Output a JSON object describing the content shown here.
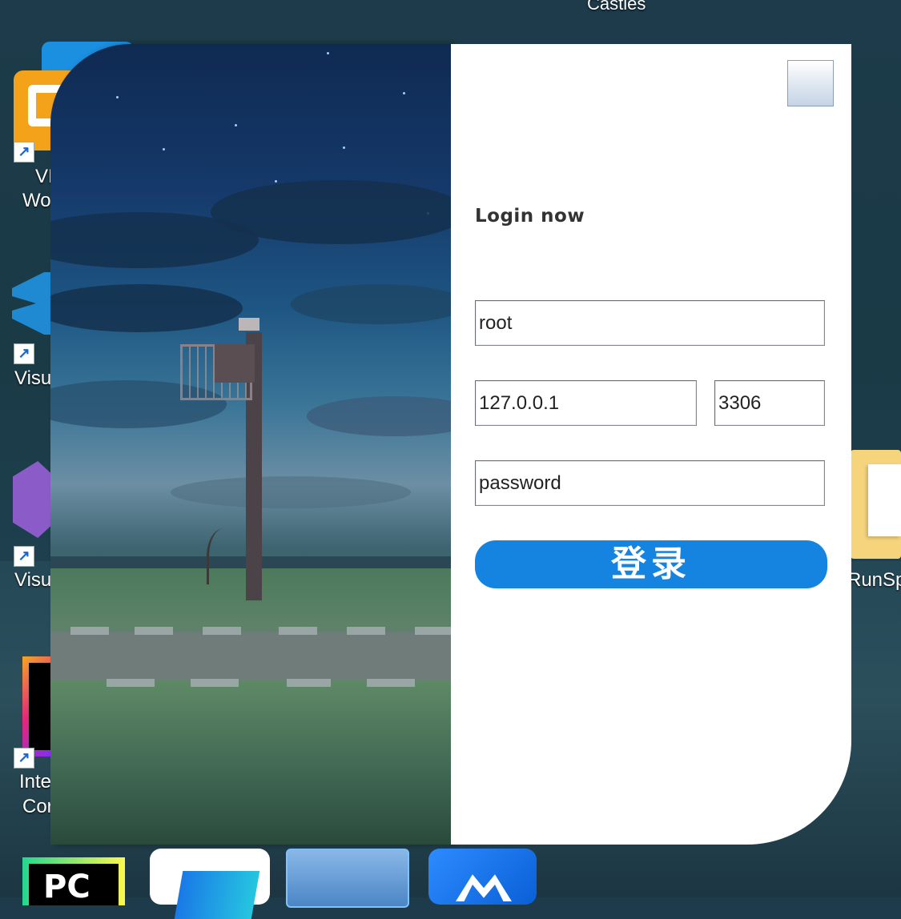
{
  "desktop": {
    "top_label": "Castles",
    "icon_labels": {
      "vmware_line1": "VI",
      "vmware_line2": "Wo",
      "vscode": "Visu",
      "visualstudio": "Visu",
      "idea_line1": "Inte",
      "idea_line2": "Cor",
      "folder": "RunSp"
    },
    "taskbar": {
      "pycharm_text": "PC"
    }
  },
  "login": {
    "title": "Login now",
    "username_value": "root",
    "host_value": "127.0.0.1",
    "port_value": "3306",
    "password_value": "password",
    "submit_label": "登录",
    "accent_color": "#1484e0"
  }
}
